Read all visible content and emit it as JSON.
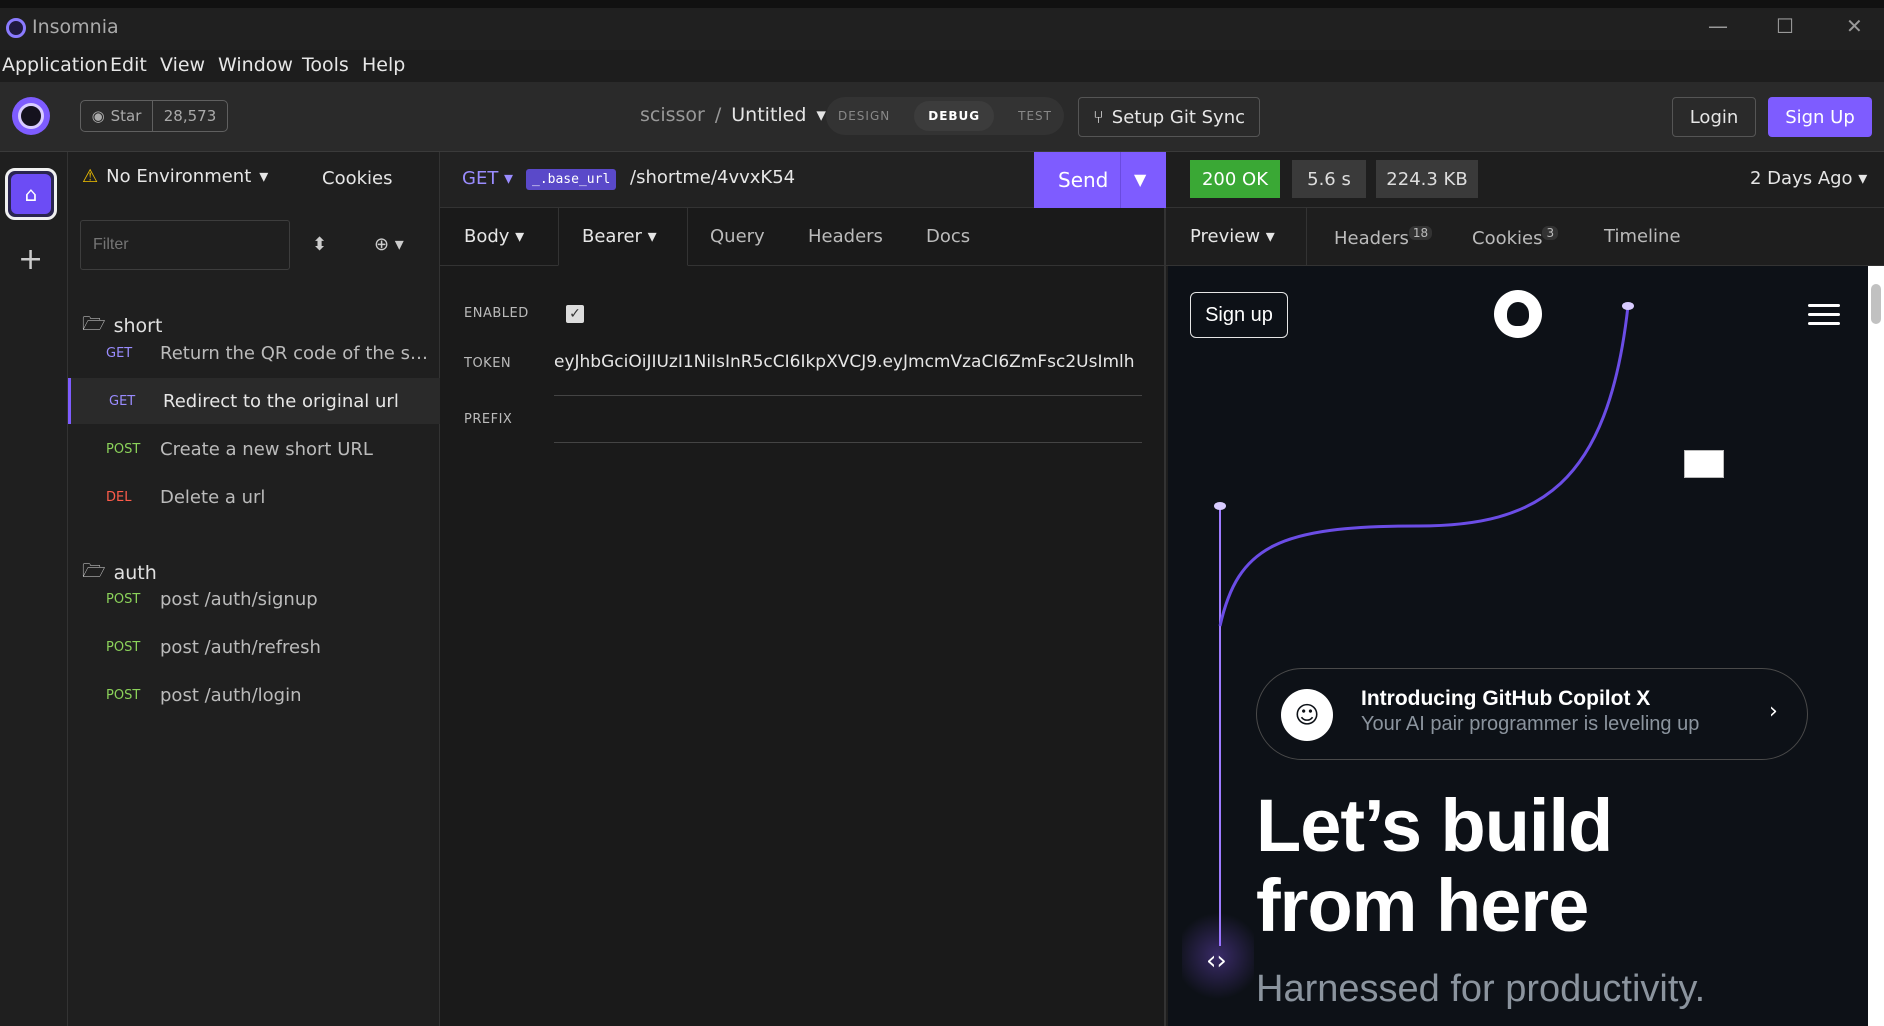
{
  "window": {
    "title": "Insomnia",
    "controls": [
      "—",
      "☐",
      "✕"
    ]
  },
  "menu": [
    "Application",
    "Edit",
    "View",
    "Window",
    "Tools",
    "Help"
  ],
  "appbar": {
    "star_label": "Star",
    "star_count": "28,573",
    "project": "scissor",
    "separator": "/",
    "document": "Untitled",
    "modes": [
      "DESIGN",
      "DEBUG",
      "TEST"
    ],
    "active_mode": "DEBUG",
    "git_sync": "Setup Git Sync",
    "login": "Login",
    "signup": "Sign Up",
    "accent": "#7e5cff"
  },
  "sidebar": {
    "environment": "No Environment",
    "cookies": "Cookies",
    "filter_placeholder": "Filter",
    "folders": [
      {
        "name": "short",
        "requests": [
          {
            "method": "GET",
            "label": "Return the QR code of the sho..."
          },
          {
            "method": "GET",
            "label": "Redirect to the original url",
            "selected": true
          },
          {
            "method": "POST",
            "label": "Create a new short URL"
          },
          {
            "method": "DEL",
            "label": "Delete a url"
          }
        ]
      },
      {
        "name": "auth",
        "requests": [
          {
            "method": "POST",
            "label": "post /auth/signup"
          },
          {
            "method": "POST",
            "label": "post /auth/refresh"
          },
          {
            "method": "POST",
            "label": "post /auth/login"
          }
        ]
      }
    ]
  },
  "request": {
    "method": "GET",
    "url_tag": "_.base_url",
    "url_path": "/shortme/4vvxK54",
    "send": "Send",
    "tabs": [
      "Body",
      "Bearer",
      "Query",
      "Headers",
      "Docs"
    ],
    "auth": {
      "enabled_label": "ENABLED",
      "token_label": "TOKEN",
      "prefix_label": "PREFIX",
      "token_value": "eyJhbGciOiJIUzI1NiIsInR5cCI6IkpXVCJ9.eyJmcmVzaCI6ZmFsc2UsImlh",
      "enabled": true
    }
  },
  "response": {
    "status": "200 OK",
    "time": "5.6 s",
    "size": "224.3 KB",
    "ago": "2 Days Ago",
    "tabs": {
      "preview": "Preview",
      "headers": "Headers",
      "headers_count": "18",
      "cookies": "Cookies",
      "cookies_count": "3",
      "timeline": "Timeline"
    },
    "status_color": "#3aa835"
  },
  "preview_page": {
    "signup": "Sign up",
    "banner_title": "Introducing GitHub Copilot X",
    "banner_sub": "Your AI pair programmer is leveling up",
    "hero_line1": "Let’s build",
    "hero_line2": "from here",
    "hero_sub": "Harnessed for productivity."
  }
}
